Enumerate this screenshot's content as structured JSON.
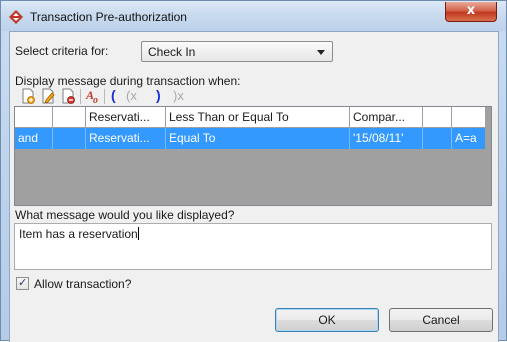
{
  "window": {
    "title": "Transaction Pre-authorization",
    "close_glyph": "x"
  },
  "criteria": {
    "label": "Select criteria for:",
    "selected": "Check In"
  },
  "display_label": "Display message during transaction when:",
  "toolbar": [
    {
      "name": "add-condition-icon"
    },
    {
      "name": "edit-condition-icon"
    },
    {
      "name": "delete-condition-icon"
    },
    {
      "name": "text-format-icon"
    },
    {
      "name": "open-paren-icon",
      "glyph": "("
    },
    {
      "name": "remove-open-paren-icon",
      "glyph": "(x"
    },
    {
      "name": "close-paren-icon",
      "glyph": ")"
    },
    {
      "name": "remove-close-paren-icon",
      "glyph": ")x"
    }
  ],
  "grid": {
    "rows": [
      [
        "",
        "",
        "Reservati...",
        "Less Than or Equal To",
        "Compar...",
        "",
        ""
      ],
      [
        "and",
        "",
        "Reservati...",
        "Equal To",
        "'15/08/11'",
        "",
        "A=a"
      ]
    ]
  },
  "message": {
    "label": "What message would you like displayed?",
    "value": "Item has a reservation"
  },
  "allow": {
    "label": "Allow transaction?",
    "checked": true,
    "tick": "✓"
  },
  "buttons": {
    "ok": "OK",
    "cancel": "Cancel"
  },
  "colors": {
    "selection": "#3399ff",
    "grid_empty": "#a0a0a0"
  }
}
